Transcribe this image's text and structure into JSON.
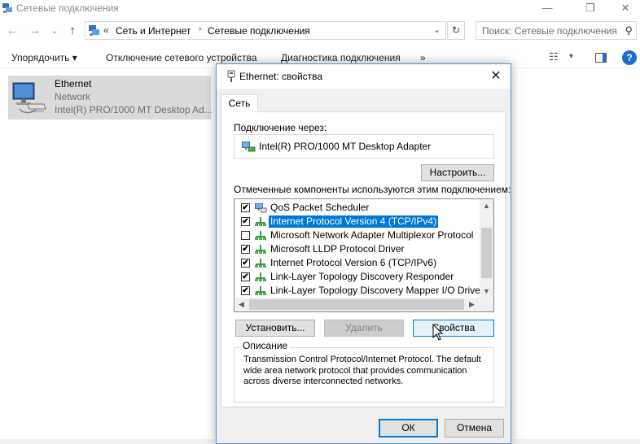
{
  "window": {
    "title": "Сетевые подключения",
    "minimize": "—",
    "maximize": "❐",
    "close": "✕"
  },
  "nav": {
    "back": "←",
    "forward": "→",
    "recent": "⌄",
    "up": "↑"
  },
  "address": {
    "overflow": "«",
    "crumbs": [
      "Сеть и Интернет",
      "Сетевые подключения"
    ],
    "separator": "›",
    "dropdown": "⌄",
    "refresh": "↻"
  },
  "search": {
    "placeholder": "Поиск: Сетевые подключения",
    "icon": "⚲"
  },
  "commandbar": {
    "organize": "Упорядочить ▾",
    "disable": "Отключение сетевого устройства",
    "diagnose": "Диагностика подключения",
    "more": "»",
    "view_options": "☷",
    "view_dropdown": "▾",
    "preview": "▯",
    "help": "?"
  },
  "adapter": {
    "name": "Ethernet",
    "network": "Network",
    "device": "Intel(R) PRO/1000 MT Desktop Ad..."
  },
  "dialog": {
    "title": "Ethernet: свойства",
    "close": "✕",
    "tab": "Сеть",
    "connect_using_label": "Подключение через:",
    "adapter_name": "Intel(R) PRO/1000 MT Desktop Adapter",
    "configure_button": "Настроить...",
    "components_label": "Отмеченные компоненты используются этим подключением:",
    "components": [
      {
        "label": "QoS Packet Scheduler",
        "checked": true,
        "icon": "scheduler-icon"
      },
      {
        "label": "Internet Protocol Version 4 (TCP/IPv4)",
        "checked": true,
        "icon": "protocol-icon",
        "selected": true
      },
      {
        "label": "Microsoft Network Adapter Multiplexor Protocol",
        "checked": false,
        "icon": "protocol-icon"
      },
      {
        "label": "Microsoft LLDP Protocol Driver",
        "checked": true,
        "icon": "protocol-icon"
      },
      {
        "label": "Internet Protocol Version 6 (TCP/IPv6)",
        "checked": true,
        "icon": "protocol-icon"
      },
      {
        "label": "Link-Layer Topology Discovery Responder",
        "checked": true,
        "icon": "protocol-icon"
      },
      {
        "label": "Link-Layer Topology Discovery Mapper I/O Driver",
        "checked": true,
        "icon": "protocol-icon"
      }
    ],
    "check_mark": "✔",
    "scroll_up": "▲",
    "scroll_down": "▼",
    "scroll_left": "◀",
    "scroll_right": "▶",
    "install_button": "Установить...",
    "uninstall_button": "Удалить",
    "properties_button": "Свойства",
    "description_legend": "Описание",
    "description": "Transmission Control Protocol/Internet Protocol. The default wide area network protocol that provides communication across diverse interconnected networks.",
    "ok_button": "ОК",
    "cancel_button": "Отмена"
  },
  "colors": {
    "accent": "#0078d7",
    "selection": "#0078d7",
    "tile_selected": "#dadada",
    "dialog_bg": "#f0f0f0"
  }
}
